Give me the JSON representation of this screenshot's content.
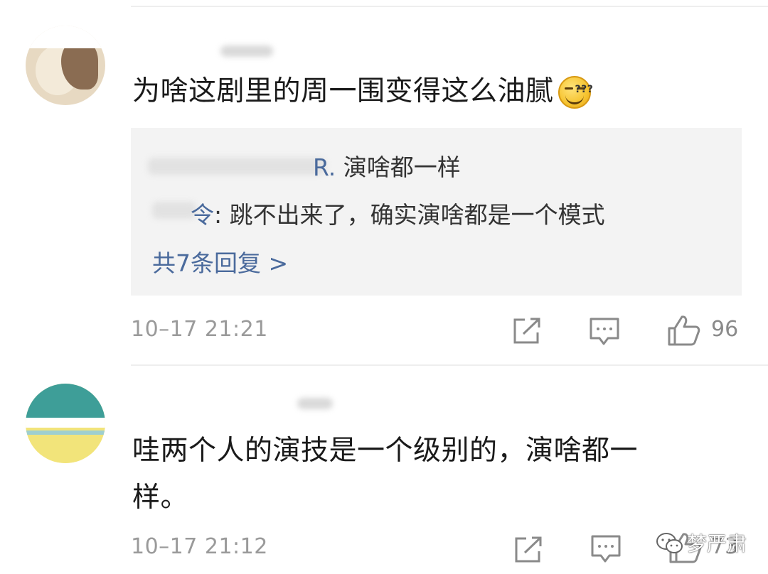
{
  "comments": [
    {
      "text": "为啥这剧里的周一围变得这么油腻",
      "emoji": "dizzy-smile-emoji",
      "replies": [
        {
          "author": "R.",
          "text": " 演啥都一样"
        },
        {
          "author": "令",
          "text": ": 跳不出来了，确实演啥都是一个模式"
        }
      ],
      "more_replies": "共7条回复 >",
      "time": "10–17 21:21",
      "likes": "96"
    },
    {
      "text_line1": "哇两个人的演技是一个级别的，演啥都一",
      "text_line2": "样。",
      "time": "10–17 21:12",
      "likes": "73"
    }
  ],
  "icons": {
    "share": "share-icon",
    "comment": "comment-icon",
    "like": "thumbs-up-icon",
    "wechat": "wechat-icon"
  },
  "watermark": "梦严肃",
  "colors": {
    "link": "#4a6a9c",
    "text": "#1a1a1a",
    "meta": "#9a9a9a",
    "reply_bg": "#f3f3f3"
  }
}
